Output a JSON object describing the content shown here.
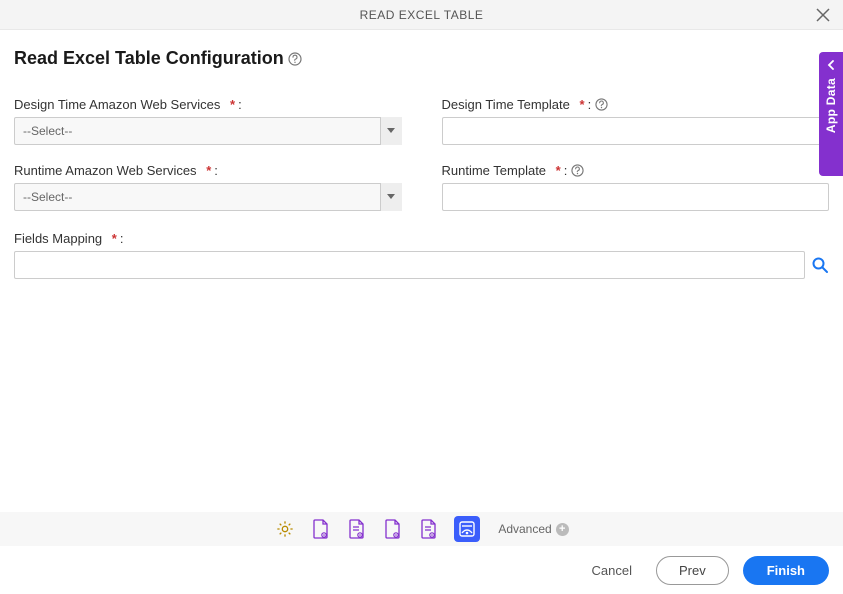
{
  "header": {
    "title": "READ EXCEL TABLE"
  },
  "page": {
    "title": "Read Excel Table Configuration"
  },
  "fields": {
    "design_aws_label": "Design Time Amazon Web Services",
    "design_aws_value": "--Select--",
    "runtime_aws_label": "Runtime Amazon Web Services",
    "runtime_aws_value": "--Select--",
    "design_template_label": "Design Time Template",
    "design_template_value": "",
    "runtime_template_label": "Runtime Template",
    "runtime_template_value": "",
    "fields_mapping_label": "Fields Mapping",
    "fields_mapping_value": ""
  },
  "side_tab": {
    "label": "App Data"
  },
  "nav": {
    "advanced_label": "Advanced"
  },
  "footer": {
    "cancel": "Cancel",
    "prev": "Prev",
    "finish": "Finish"
  }
}
